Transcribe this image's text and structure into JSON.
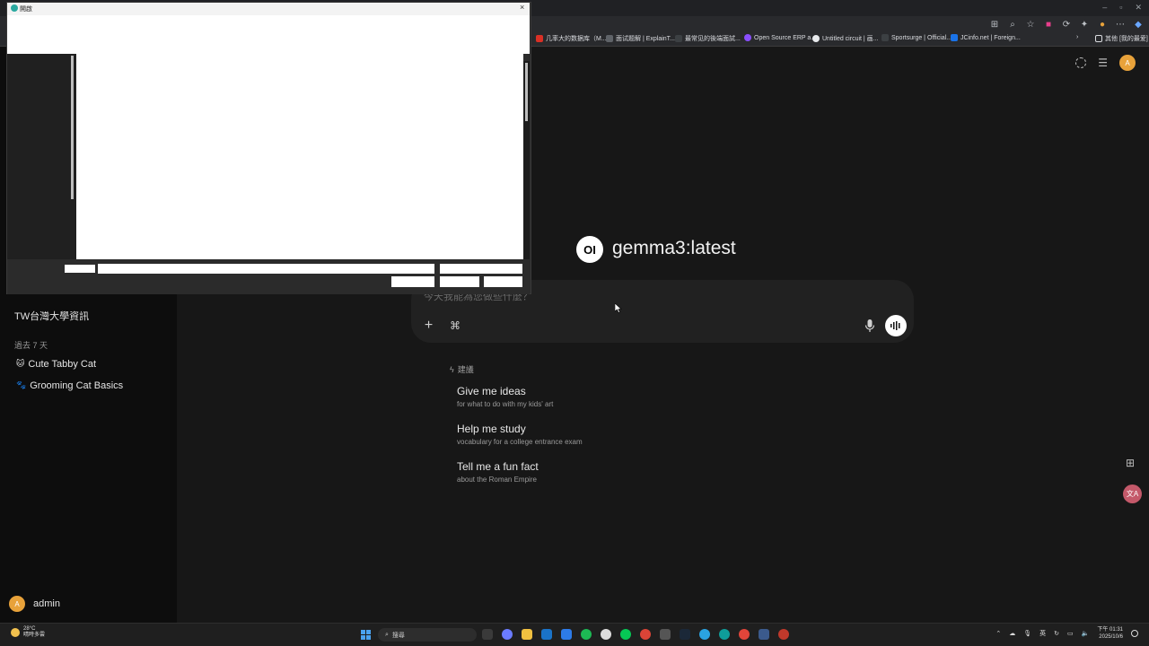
{
  "browser": {
    "bookmarks": [
      {
        "label": "几率大的数据库（M...",
        "color": "#d93025"
      },
      {
        "label": "面试题解 | ExplainT...",
        "color": "#5f6368"
      },
      {
        "label": "最常见的後端面試...",
        "color": "#3c4043"
      },
      {
        "label": "Open Source ERP a...",
        "color": "#8a4fff"
      },
      {
        "label": "Untitled circuit | 画...",
        "color": "#e8eaed"
      },
      {
        "label": "Sportsurge | Official...",
        "color": "#3c4043"
      },
      {
        "label": "JCinfo.net | Foreign...",
        "color": "#1a73e8"
      }
    ],
    "bookmarks_folder": "其他 [我的最爱]"
  },
  "sidebar": {
    "partial_item": "TW台灣大學資訊",
    "section_label": "過去 7 天",
    "chats": [
      {
        "emoji": "🐱",
        "label": "Cute Tabby Cat"
      },
      {
        "emoji": "🐾",
        "label": "Grooming Cat Basics"
      }
    ],
    "user": {
      "initial": "A",
      "name": "admin"
    }
  },
  "header": {
    "avatar_initial": "A"
  },
  "main": {
    "model_logo": "OI",
    "model_name": "gemma3:latest",
    "composer_placeholder": "今天我能為您做些什麼？",
    "suggestions_label": "建議",
    "suggestions": [
      {
        "title": "Give me ideas",
        "subtitle": "for what to do with my kids' art"
      },
      {
        "title": "Help me study",
        "subtitle": "vocabulary for a college entrance exam"
      },
      {
        "title": "Tell me a fun fact",
        "subtitle": "about the Roman Empire"
      }
    ],
    "translate_label": "文A"
  },
  "dialog": {
    "title": "開啟",
    "close_glyph": "×"
  },
  "taskbar": {
    "temp": "28°C",
    "weather": "晴時多雲",
    "search_placeholder": "搜尋",
    "ime": "英",
    "time": "下午 01:31",
    "date": "2025/10/6"
  },
  "colors": {
    "accent": "#e8a23a",
    "background": "#171717",
    "sidebar": "#0d0d0d"
  }
}
